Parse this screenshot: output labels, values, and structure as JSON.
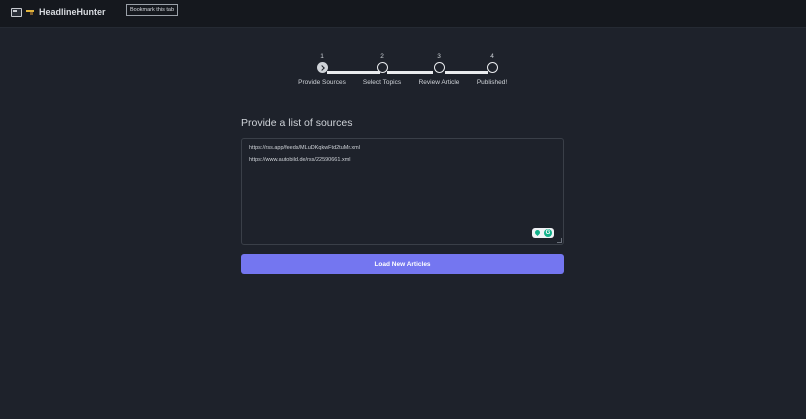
{
  "app": {
    "title": "HeadlineHunter",
    "tooltip": "Bookmark this tab"
  },
  "stepper": {
    "steps": [
      {
        "number": "1",
        "label": "Provide Sources",
        "state": "active"
      },
      {
        "number": "2",
        "label": "Select Topics",
        "state": "pending"
      },
      {
        "number": "3",
        "label": "Review Article",
        "state": "pending"
      },
      {
        "number": "4",
        "label": "Published!",
        "state": "pending"
      }
    ]
  },
  "main": {
    "title": "Provide a list of sources",
    "sources": [
      "https://rss.app/feeds/MLuDKqkwFtd2tuMr.xml",
      "https://www.autobild.de/rss/22590661.xml"
    ],
    "load_button": "Load New Articles"
  },
  "colors": {
    "background": "#1e222b",
    "topbar": "#15181e",
    "accent": "#7476f0",
    "extension": "#12b08a"
  },
  "icons": {
    "brand": "window-icon",
    "brand_secondary": "gun-icon",
    "step_done": "chevron-right-icon",
    "extension_1": "pin-icon",
    "extension_2": "grammar-g-icon"
  }
}
